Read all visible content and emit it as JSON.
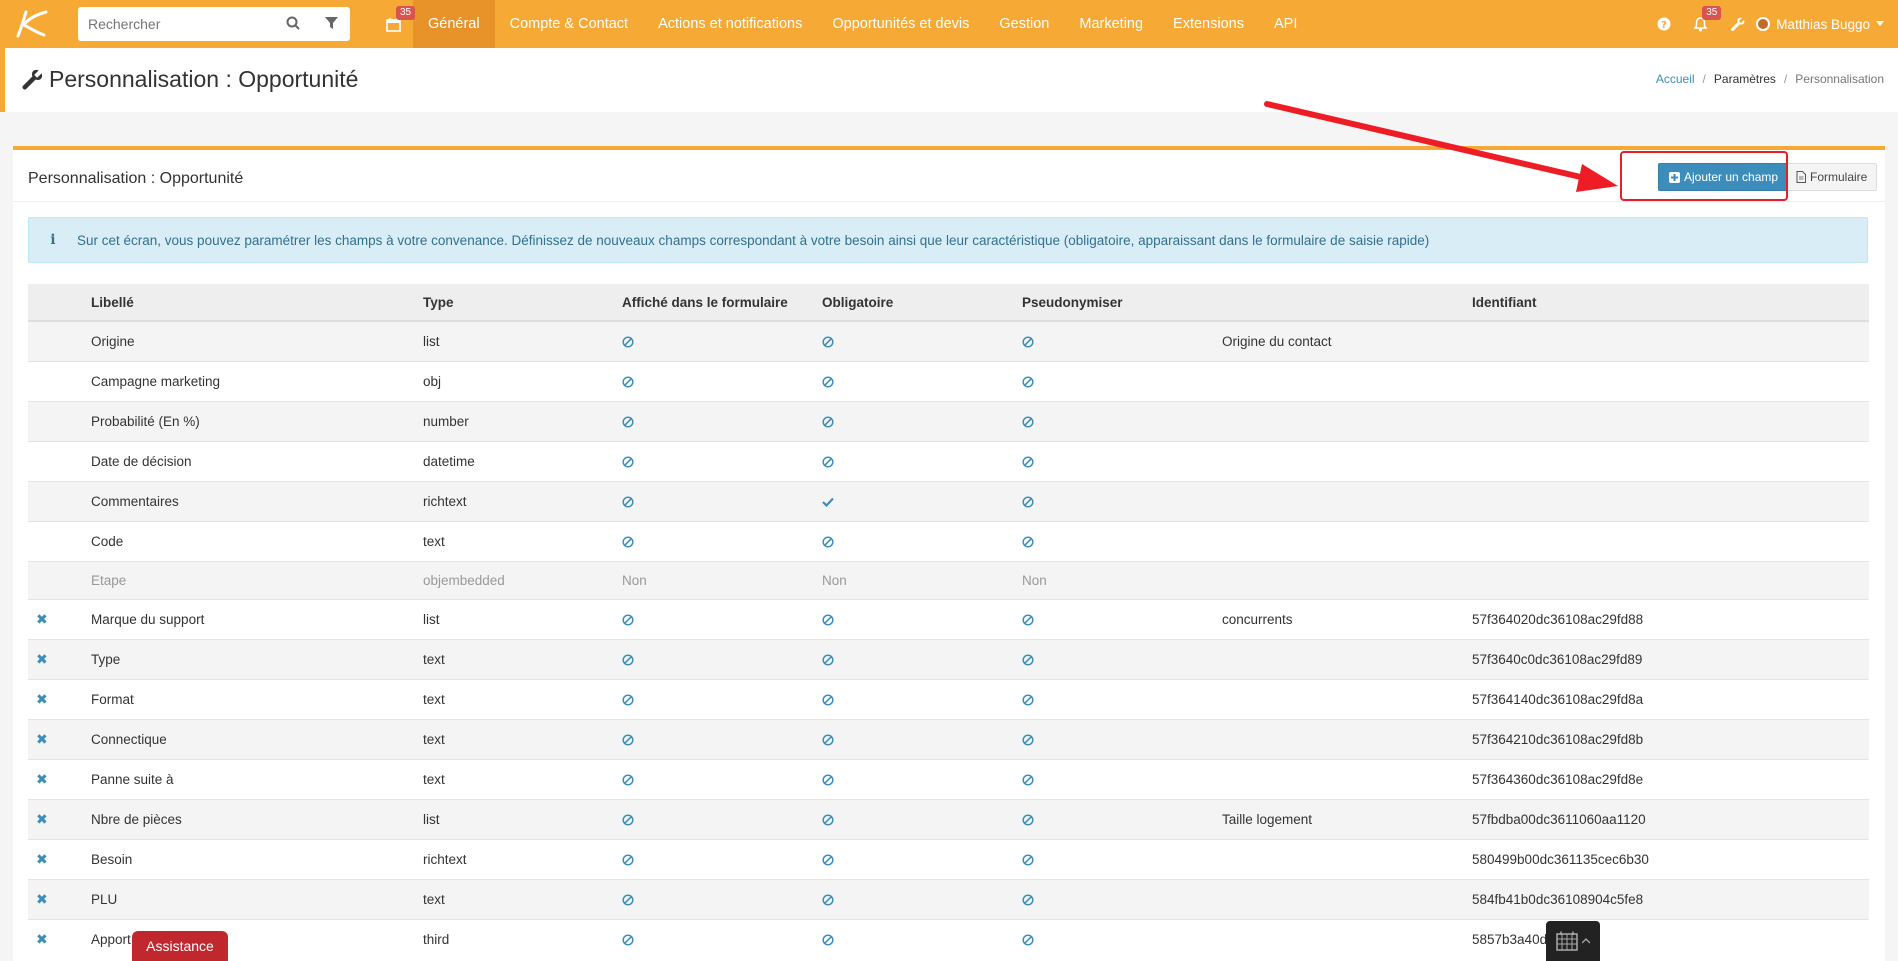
{
  "topbar": {
    "search_placeholder": "Rechercher",
    "calendar_badge": "35",
    "notifications_badge": "35",
    "nav": [
      "Général",
      "Compte & Contact",
      "Actions et notifications",
      "Opportunités et devis",
      "Gestion",
      "Marketing",
      "Extensions",
      "API"
    ],
    "user_name": "Matthias Buggo"
  },
  "header": {
    "title": "Personnalisation : Opportunité",
    "breadcrumb": [
      "Accueil",
      "Paramètres",
      "Personnalisation"
    ]
  },
  "panel": {
    "title": "Personnalisation : Opportunité",
    "add_button": "Ajouter un champ",
    "form_button": "Formulaire",
    "info_icon": "i",
    "info_text": "Sur cet écran, vous pouvez paramétrer les champs à votre convenance. Définissez de nouveaux champs correspondant à votre besoin ainsi que leur caractéristique (obligatoire, apparaissant dans le formulaire de saisie rapide)"
  },
  "table": {
    "headers": [
      "Libellé",
      "Type",
      "Affiché dans le formulaire",
      "Obligatoire",
      "Pseudonymiser",
      "",
      "Identifiant"
    ],
    "rows": [
      {
        "del": false,
        "label": "Origine",
        "type": "list",
        "form": "ban",
        "req": "ban",
        "pseudo": "ban",
        "extra": "Origine du contact",
        "id": "",
        "link": false
      },
      {
        "del": false,
        "label": "Campagne marketing",
        "type": "obj",
        "form": "ban",
        "req": "ban",
        "pseudo": "ban",
        "extra": "",
        "id": "",
        "link": false
      },
      {
        "del": false,
        "label": "Probabilité (En %)",
        "type": "number",
        "form": "ban",
        "req": "ban",
        "pseudo": "ban",
        "extra": "",
        "id": "",
        "link": false
      },
      {
        "del": false,
        "label": "Date de décision",
        "type": "datetime",
        "form": "ban",
        "req": "ban",
        "pseudo": "ban",
        "extra": "",
        "id": "",
        "link": false
      },
      {
        "del": false,
        "label": "Commentaires",
        "type": "richtext",
        "form": "ban",
        "req": "check",
        "pseudo": "ban",
        "extra": "",
        "id": "",
        "link": false
      },
      {
        "del": false,
        "label": "Code",
        "type": "text",
        "form": "ban",
        "req": "ban",
        "pseudo": "ban",
        "extra": "",
        "id": "",
        "link": false
      },
      {
        "del": false,
        "label": "Etape",
        "type": "objembedded",
        "form": "Non",
        "req": "Non",
        "pseudo": "Non",
        "extra": "",
        "id": "",
        "link": false,
        "disabled": true
      },
      {
        "del": true,
        "label": "Marque du support",
        "type": "list",
        "form": "ban",
        "req": "ban",
        "pseudo": "ban",
        "extra": "concurrents",
        "id": "57f364020dc36108ac29fd88",
        "link": true
      },
      {
        "del": true,
        "label": "Type",
        "type": "text",
        "form": "ban",
        "req": "ban",
        "pseudo": "ban",
        "extra": "",
        "id": "57f3640c0dc36108ac29fd89",
        "link": true
      },
      {
        "del": true,
        "label": "Format",
        "type": "text",
        "form": "ban",
        "req": "ban",
        "pseudo": "ban",
        "extra": "",
        "id": "57f364140dc36108ac29fd8a",
        "link": true
      },
      {
        "del": true,
        "label": "Connectique",
        "type": "text",
        "form": "ban",
        "req": "ban",
        "pseudo": "ban",
        "extra": "",
        "id": "57f364210dc36108ac29fd8b",
        "link": true
      },
      {
        "del": true,
        "label": "Panne suite à",
        "type": "text",
        "form": "ban",
        "req": "ban",
        "pseudo": "ban",
        "extra": "",
        "id": "57f364360dc36108ac29fd8e",
        "link": true
      },
      {
        "del": true,
        "label": "Nbre de pièces",
        "type": "list",
        "form": "ban",
        "req": "ban",
        "pseudo": "ban",
        "extra": "Taille logement",
        "id": "57fbdba00dc3611060aa1120",
        "link": true
      },
      {
        "del": true,
        "label": "Besoin",
        "type": "richtext",
        "form": "ban",
        "req": "ban",
        "pseudo": "ban",
        "extra": "",
        "id": "580499b00dc361135cec6b30",
        "link": true
      },
      {
        "del": true,
        "label": "PLU",
        "type": "text",
        "form": "ban",
        "req": "ban",
        "pseudo": "ban",
        "extra": "",
        "id": "584fb41b0dc36108904c5fe8",
        "link": true
      },
      {
        "del": true,
        "label": "Apport",
        "type": "third",
        "form": "ban",
        "req": "ban",
        "pseudo": "ban",
        "extra": "",
        "id": "5857b3a40d                6ae60",
        "link": true
      }
    ]
  },
  "floating": {
    "assistance": "Assistance"
  },
  "colors": {
    "brand": "#f7a935",
    "primary": "#3c8dbc",
    "danger": "#d9534f",
    "annotation": "#ee1c25"
  }
}
